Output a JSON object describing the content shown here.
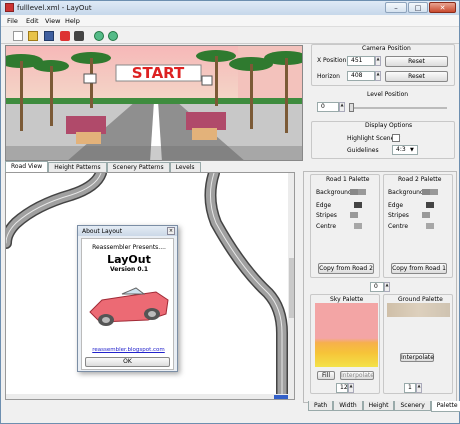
{
  "window": {
    "title": "fulllevel.xml - LayOut"
  },
  "menu": [
    "File",
    "Edit",
    "View",
    "Help"
  ],
  "scene": {
    "start_text": "START"
  },
  "camera": {
    "heading": "Camera Position",
    "x_label": "X Position",
    "x_value": "451",
    "horizon_label": "Horizon",
    "horizon_value": "408",
    "reset": "Reset"
  },
  "level": {
    "heading": "Level Position",
    "value": "0"
  },
  "display": {
    "heading": "Display Options",
    "highlight": "Highlight Scenery",
    "guidelines": "Guidelines",
    "guidelines_value": "4:3"
  },
  "tabs_top": [
    "Road View",
    "Height Patterns",
    "Scenery Patterns",
    "Levels"
  ],
  "road1": {
    "heading": "Road 1 Palette",
    "rows": [
      "Background",
      "Edge",
      "Stripes",
      "Centre"
    ],
    "copy": "Copy from Road 2"
  },
  "road2": {
    "heading": "Road 2 Palette",
    "rows": [
      "Background",
      "Edge",
      "Stripes",
      "Centre"
    ],
    "copy": "Copy from Road 1"
  },
  "palette_index": "0",
  "sky": {
    "heading": "Sky Palette",
    "fill": "Fill",
    "interpolate": "Interpolate",
    "value": "12"
  },
  "ground": {
    "heading": "Ground Palette",
    "interpolate": "Interpolate",
    "value": "1"
  },
  "tabs_bottom": [
    "Path",
    "Width",
    "Height",
    "Scenery",
    "Palette"
  ],
  "about": {
    "title": "About Layout",
    "presents": "Reassembler Presents....",
    "app": "LayOut",
    "version": "Version 0.1",
    "link": "reassembler.blogspot.com",
    "ok": "OK"
  },
  "colors": {
    "titlebar": "#c6d7ea",
    "sky_pink": "#f2a6a6",
    "sky_yellow": "#f5d52a",
    "road": "#8f8f8f",
    "car": "#e8636f"
  }
}
